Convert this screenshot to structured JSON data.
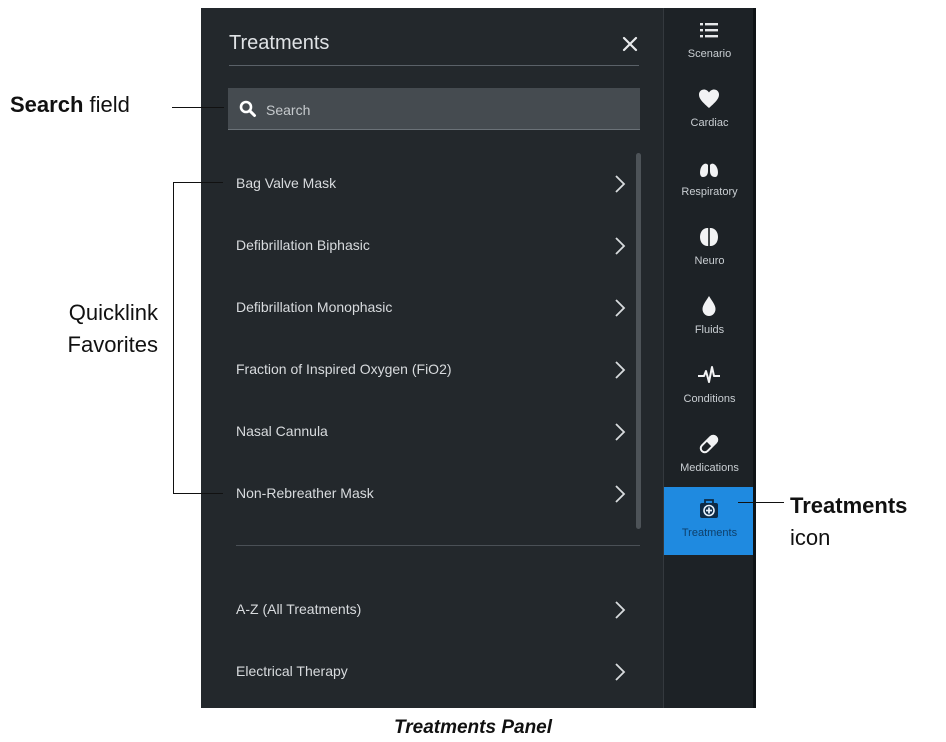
{
  "panel": {
    "title": "Treatments",
    "close_icon": "close-icon"
  },
  "search": {
    "placeholder": "Search",
    "value": "",
    "icon": "search-icon"
  },
  "favorites": [
    {
      "label": "Bag Valve Mask"
    },
    {
      "label": "Defibrillation Biphasic"
    },
    {
      "label": "Defibrillation Monophasic"
    },
    {
      "label": "Fraction of Inspired Oxygen (FiO2)"
    },
    {
      "label": "Nasal Cannula"
    },
    {
      "label": "Non-Rebreather Mask"
    }
  ],
  "categories": [
    {
      "label": "A-Z (All Treatments)"
    },
    {
      "label": "Electrical Therapy"
    }
  ],
  "sidebar": {
    "items": [
      {
        "label": "Scenario",
        "icon": "list-icon",
        "active": false
      },
      {
        "label": "Cardiac",
        "icon": "heart-icon",
        "active": false
      },
      {
        "label": "Respiratory",
        "icon": "lungs-icon",
        "active": false
      },
      {
        "label": "Neuro",
        "icon": "brain-icon",
        "active": false
      },
      {
        "label": "Fluids",
        "icon": "droplet-icon",
        "active": false
      },
      {
        "label": "Conditions",
        "icon": "heartbeat-icon",
        "active": false
      },
      {
        "label": "Medications",
        "icon": "pill-icon",
        "active": false
      },
      {
        "label": "Treatments",
        "icon": "medkit-icon",
        "active": true
      }
    ]
  },
  "annotations": {
    "search_bold": "Search",
    "search_rest": "field",
    "quick_line1": "Quicklink",
    "quick_line2": "Favorites",
    "treat_bold": "Treatments",
    "treat_rest": "icon"
  },
  "caption": "Treatments Panel",
  "colors": {
    "panel_bg": "#23282c",
    "sidebar_bg": "#1d2226",
    "accent": "#1f8ae0"
  }
}
